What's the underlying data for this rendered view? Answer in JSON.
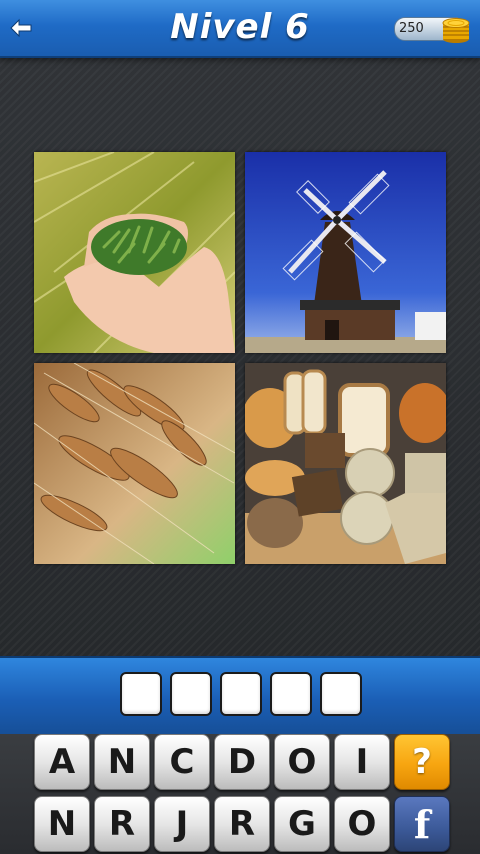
{
  "header": {
    "title": "Nivel 6",
    "coins": "250"
  },
  "images": [
    {
      "name": "grain-in-hands"
    },
    {
      "name": "windmill"
    },
    {
      "name": "wheat-ears"
    },
    {
      "name": "bread-assortment"
    }
  ],
  "answer": {
    "slots": [
      "",
      "",
      "",
      "",
      ""
    ]
  },
  "keyboard": {
    "row1": [
      "A",
      "N",
      "C",
      "D",
      "O",
      "I"
    ],
    "row2": [
      "N",
      "R",
      "J",
      "R",
      "G",
      "O"
    ],
    "hint_label": "?",
    "facebook_label": "f"
  },
  "colors": {
    "header_blue": "#1f6bc6",
    "hint_orange": "#f7a510",
    "facebook_blue": "#3b5998"
  }
}
